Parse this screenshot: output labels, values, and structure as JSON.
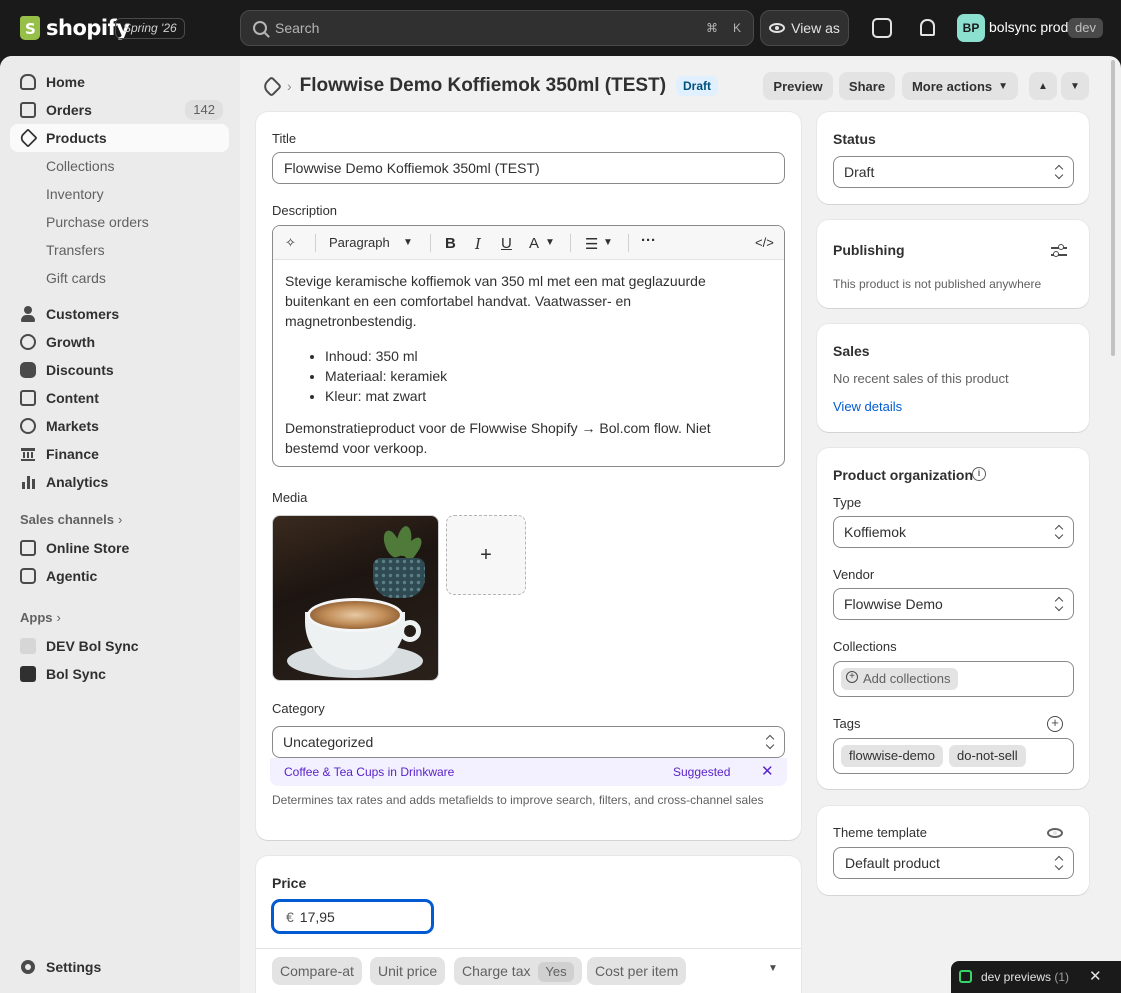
{
  "topbar": {
    "logo_text": "shopify",
    "edition": "Spring '26",
    "search_placeholder": "Search",
    "search_shortcut_1": "⌘",
    "search_shortcut_2": "K",
    "view_as": "View as",
    "avatar_initials": "BP",
    "store_name": "bolsync prod",
    "env_badge": "dev"
  },
  "sidebar": {
    "home": "Home",
    "orders": "Orders",
    "orders_count": "142",
    "products": "Products",
    "products_sub": [
      "Collections",
      "Inventory",
      "Purchase orders",
      "Transfers",
      "Gift cards"
    ],
    "customers": "Customers",
    "growth": "Growth",
    "discounts": "Discounts",
    "content": "Content",
    "markets": "Markets",
    "finance": "Finance",
    "analytics": "Analytics",
    "sales_channels": "Sales channels",
    "online_store": "Online Store",
    "agentic": "Agentic",
    "apps": "Apps",
    "app_dev": "DEV Bol Sync",
    "app_bol": "Bol Sync",
    "settings": "Settings"
  },
  "header": {
    "title": "Flowwise Demo Koffiemok 350ml (TEST)",
    "status_badge": "Draft",
    "preview": "Preview",
    "share": "Share",
    "more_actions": "More actions"
  },
  "product": {
    "title_label": "Title",
    "title_value": "Flowwise Demo Koffiemok 350ml (TEST)",
    "description_label": "Description",
    "paragraph_style": "Paragraph",
    "desc_p1": "Stevige keramische koffiemok van 350 ml met een mat geglazuurde buitenkant en een comfortabel handvat. Vaatwasser- en magnetronbestendig.",
    "desc_list": [
      "Inhoud: 350 ml",
      "Materiaal: keramiek",
      "Kleur: mat zwart"
    ],
    "desc_p2": "Demonstratieproduct voor de Flowwise Shopify → Bol.com flow. Niet bestemd voor verkoop.",
    "media_label": "Media",
    "media_add": "+",
    "category_label": "Category",
    "category_value": "Uncategorized",
    "suggested_category": "Coffee & Tea Cups",
    "suggested_in": "in",
    "suggested_parent": "Drinkware",
    "suggested_tag": "Suggested",
    "category_help": "Determines tax rates and adds metafields to improve search, filters, and cross-channel sales"
  },
  "pricing": {
    "price_label": "Price",
    "currency": "€",
    "price_value": "17,95",
    "compare_at": "Compare-at",
    "unit_price": "Unit price",
    "charge_tax": "Charge tax",
    "charge_tax_value": "Yes",
    "cost_per_item": "Cost per item"
  },
  "status_card": {
    "label": "Status",
    "value": "Draft"
  },
  "publishing_card": {
    "title": "Publishing",
    "text": "This product is not published anywhere"
  },
  "sales_card": {
    "title": "Sales",
    "text": "No recent sales of this product",
    "link": "View details"
  },
  "organization": {
    "title": "Product organization",
    "type_label": "Type",
    "type_value": "Koffiemok",
    "vendor_label": "Vendor",
    "vendor_value": "Flowwise Demo",
    "collections_label": "Collections",
    "add_collections": "Add collections",
    "tags_label": "Tags",
    "tags": [
      "flowwise-demo",
      "do-not-sell"
    ]
  },
  "theme_card": {
    "label": "Theme template",
    "value": "Default product"
  },
  "dev_toast": {
    "label": "dev previews",
    "count": "(1)"
  },
  "colors": {
    "accent": "#005bd3",
    "sidebar": "#ebebeb",
    "topbar": "#1a1a1a",
    "suggest": "#5a24c7"
  }
}
